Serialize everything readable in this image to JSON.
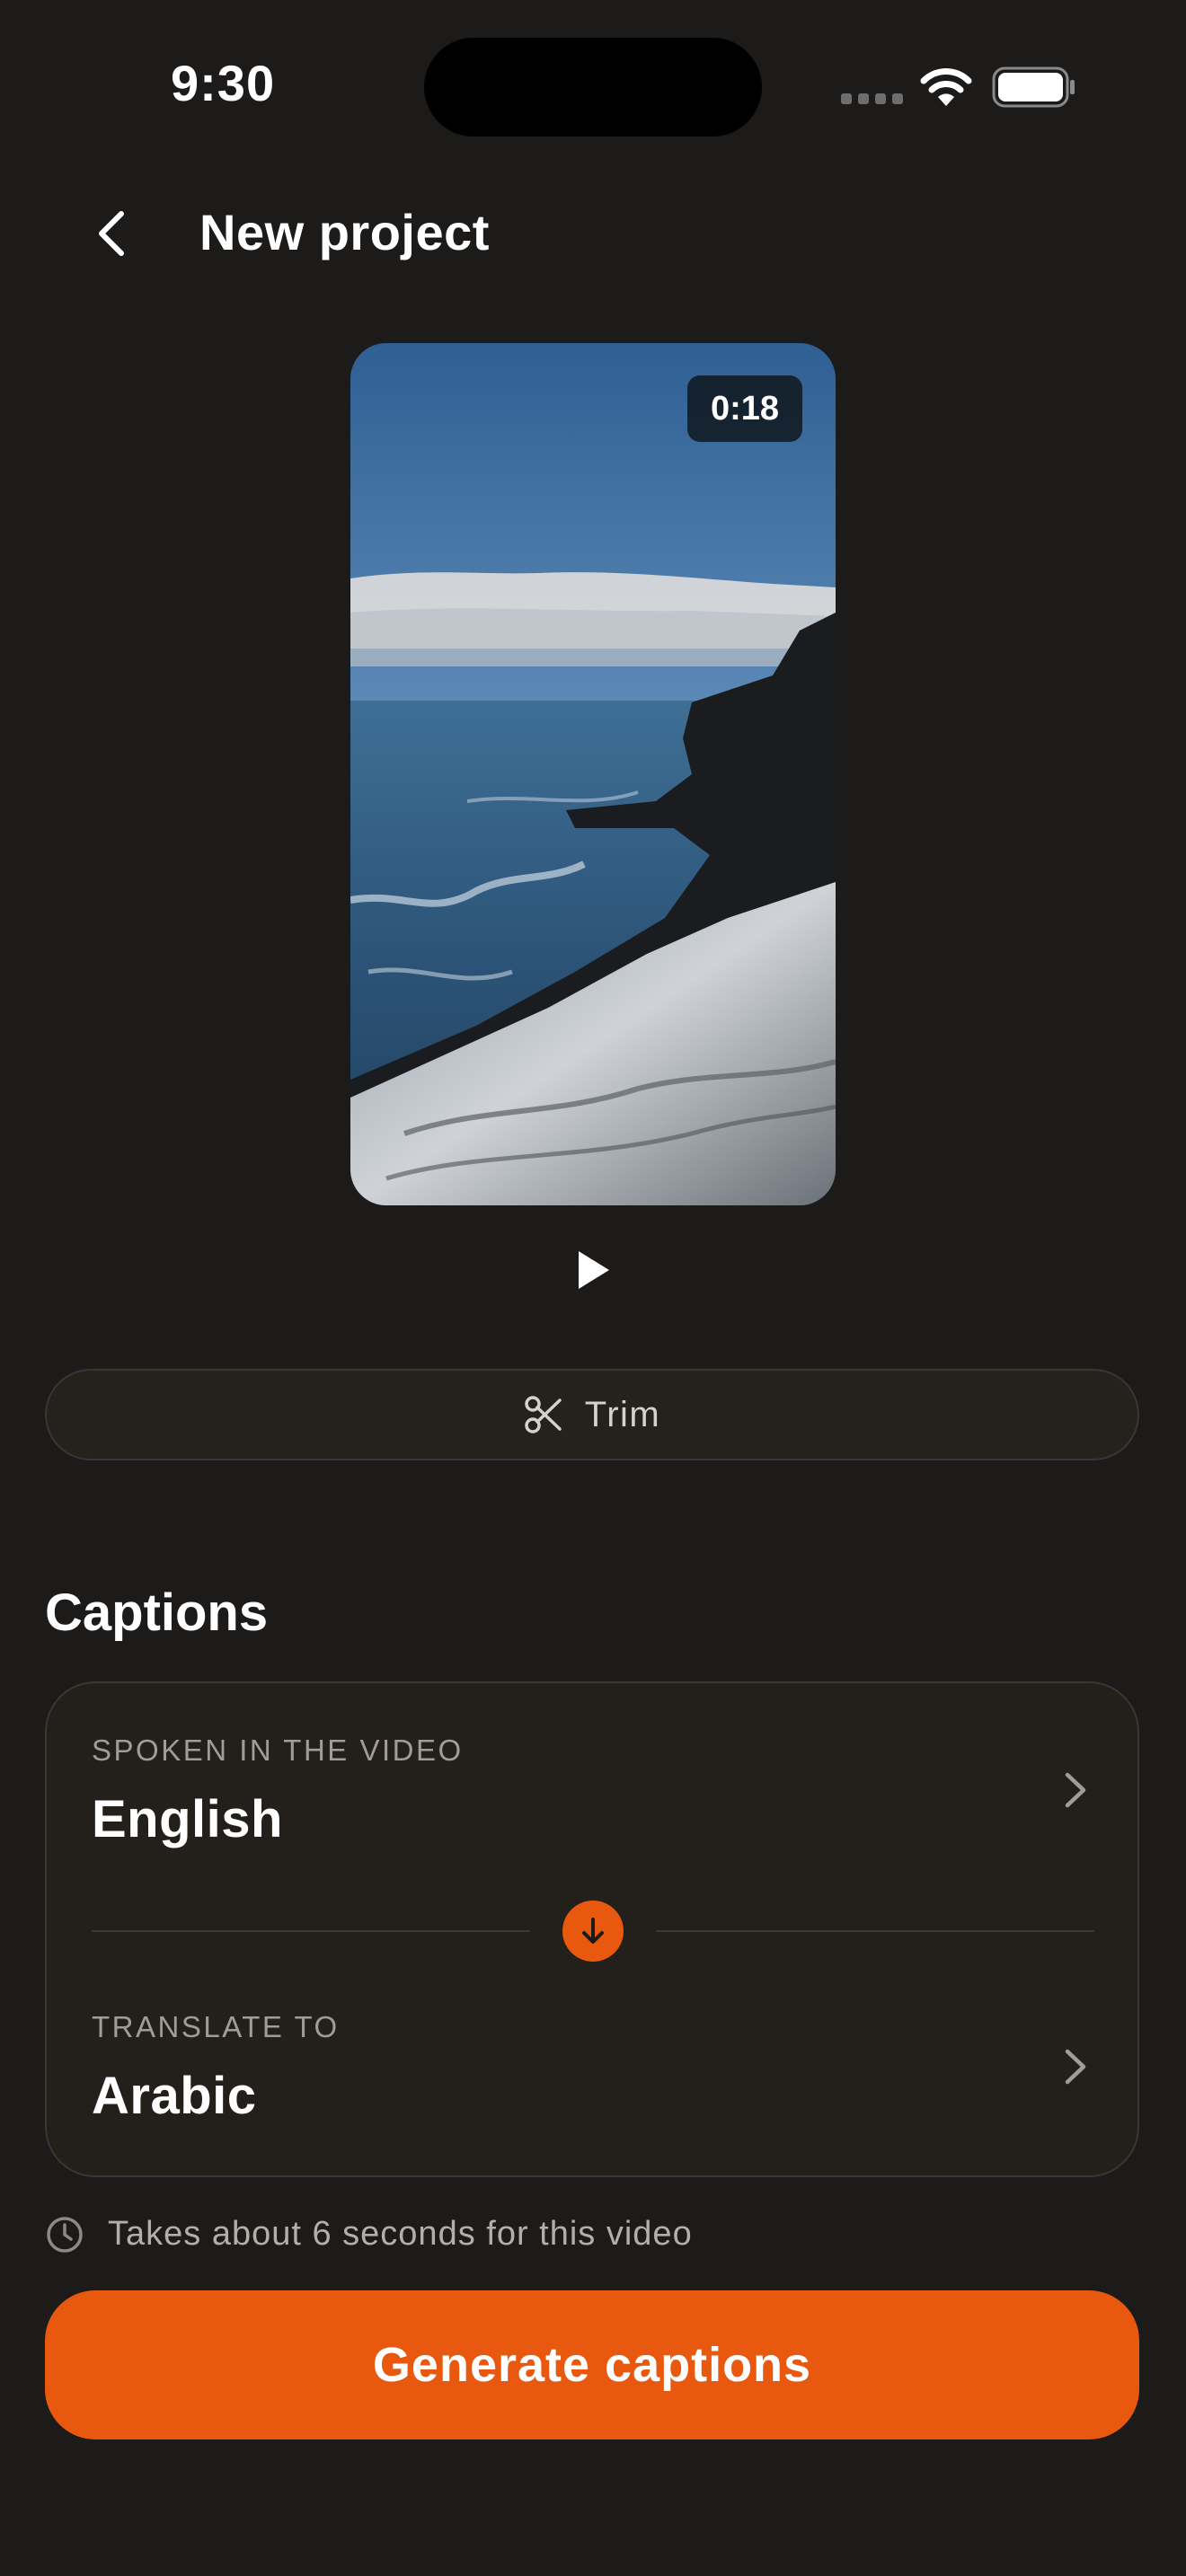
{
  "status_bar": {
    "time": "9:30"
  },
  "header": {
    "title": "New project",
    "back_icon": "chevron-left-icon"
  },
  "preview": {
    "duration": "0:18",
    "play_icon": "play-icon"
  },
  "trim": {
    "label": "Trim",
    "icon": "scissors-icon"
  },
  "captions": {
    "heading": "Captions",
    "spoken_label": "SPOKEN IN THE VIDEO",
    "spoken_value": "English",
    "translate_label": "TRANSLATE TO",
    "translate_value": "Arabic",
    "swap_icon": "arrow-down-icon",
    "estimate": "Takes about 6 seconds for this video",
    "estimate_icon": "clock-icon"
  },
  "generate": {
    "label": "Generate captions"
  },
  "colors": {
    "accent": "#e8590f",
    "background": "#1c1b1a",
    "card": "#23201b"
  }
}
